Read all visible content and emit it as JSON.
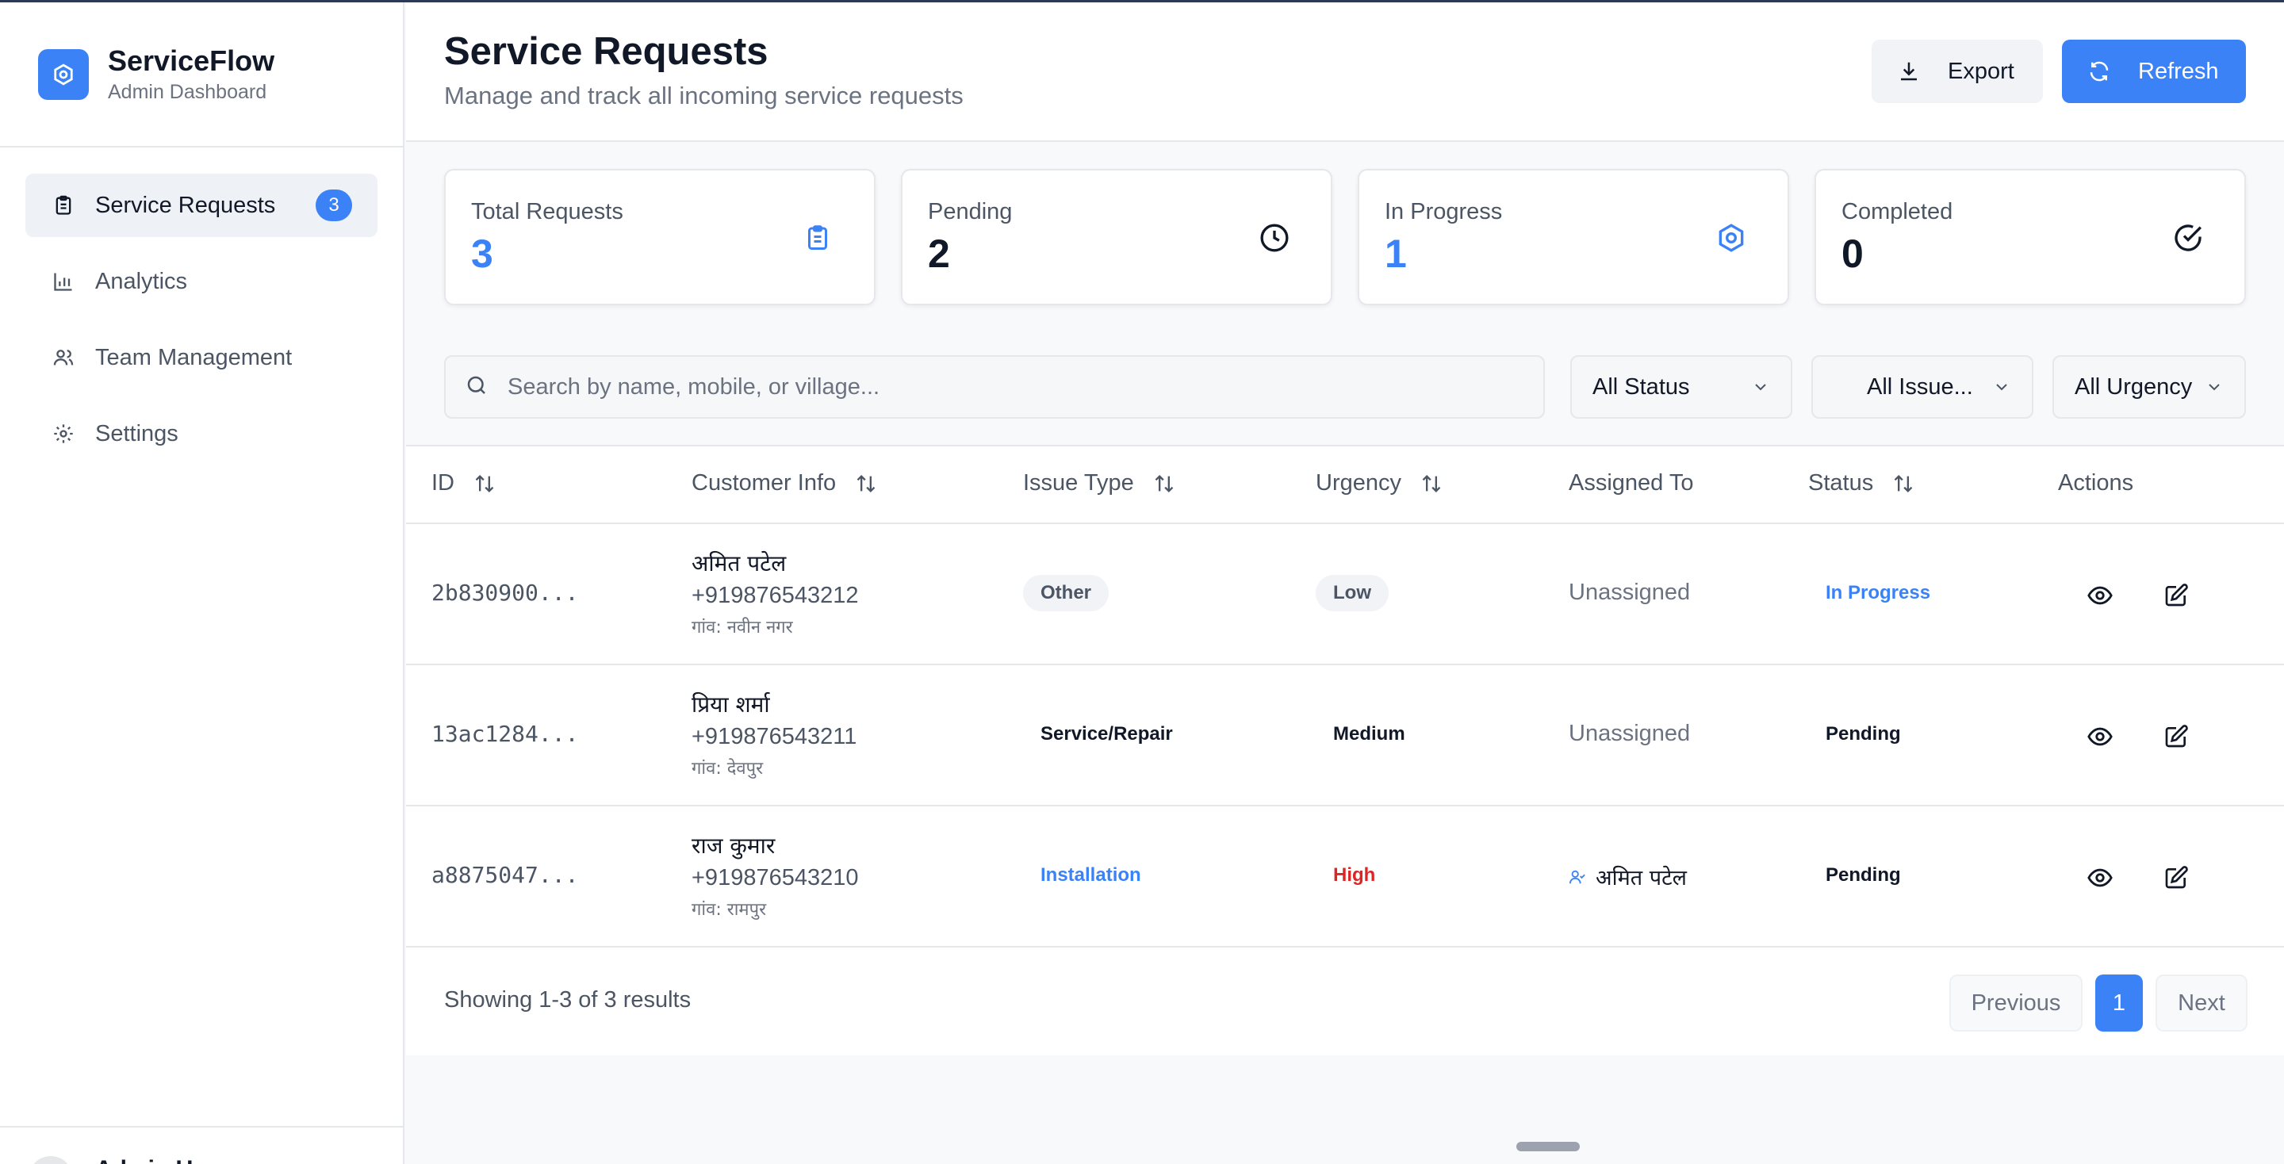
{
  "app": {
    "name": "ServiceFlow",
    "subtitle": "Admin Dashboard"
  },
  "sidebar": {
    "items": [
      {
        "label": "Service Requests",
        "icon": "clipboard-icon",
        "badge": "3",
        "active": true
      },
      {
        "label": "Analytics",
        "icon": "bar-chart-icon"
      },
      {
        "label": "Team Management",
        "icon": "users-icon"
      },
      {
        "label": "Settings",
        "icon": "gear-icon"
      }
    ],
    "footer": {
      "user_name": "Admin U..."
    }
  },
  "header": {
    "title": "Service Requests",
    "subtitle": "Manage and track all incoming service requests",
    "export_label": "Export",
    "refresh_label": "Refresh"
  },
  "stats": [
    {
      "label": "Total Requests",
      "value": "3",
      "color": "#3b82f6",
      "icon": "clipboard-icon"
    },
    {
      "label": "Pending",
      "value": "2",
      "color": "#111827",
      "icon": "clock-icon"
    },
    {
      "label": "In Progress",
      "value": "1",
      "color": "#3b82f6",
      "icon": "gear-icon"
    },
    {
      "label": "Completed",
      "value": "0",
      "color": "#111827",
      "icon": "check-circle-icon"
    }
  ],
  "filters": {
    "search_placeholder": "Search by name, mobile, or village...",
    "status": "All Status",
    "issue": "All Issue...",
    "urgency": "All Urgency"
  },
  "table": {
    "columns": [
      "ID",
      "Customer Info",
      "Issue Type",
      "Urgency",
      "Assigned To",
      "Status",
      "Actions"
    ],
    "rows": [
      {
        "id": "2b830900...",
        "name": "अमित पटेल",
        "phone": "+919876543212",
        "village": "गांव: नवीन नगर",
        "issue": "Other",
        "urgency": "Low",
        "assigned": "Unassigned",
        "status": "In Progress"
      },
      {
        "id": "13ac1284...",
        "name": "प्रिया शर्मा",
        "phone": "+919876543211",
        "village": "गांव: देवपुर",
        "issue": "Service/Repair",
        "urgency": "Medium",
        "assigned": "Unassigned",
        "status": "Pending"
      },
      {
        "id": "a8875047...",
        "name": "राज कुमार",
        "phone": "+919876543210",
        "village": "गांव: रामपुर",
        "issue": "Installation",
        "urgency": "High",
        "assigned": "अमित पटेल",
        "status": "Pending"
      }
    ]
  },
  "footer": {
    "showing": "Showing 1-3 of 3 results",
    "previous": "Previous",
    "page": "1",
    "next": "Next"
  },
  "colors": {
    "accent": "#3b82f6",
    "danger": "#dc2626",
    "muted": "#6b7280"
  }
}
